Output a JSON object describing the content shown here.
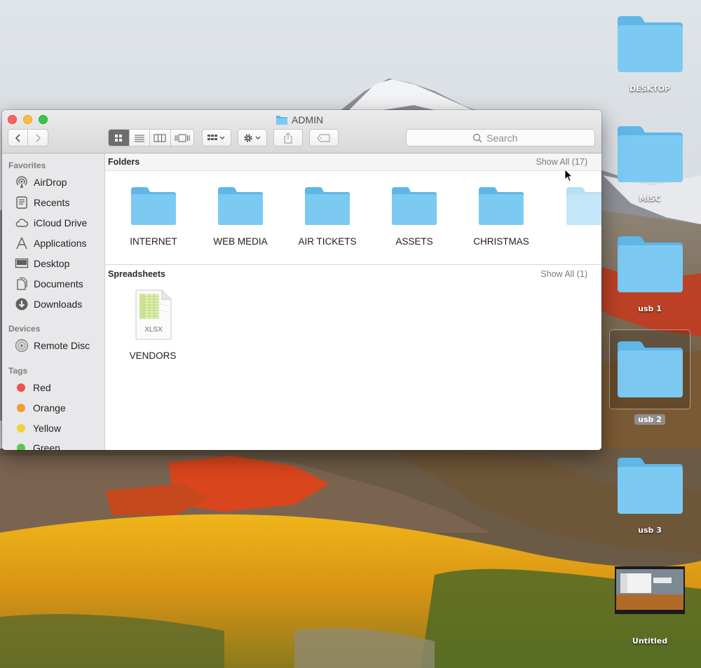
{
  "window": {
    "title": "ADMIN"
  },
  "toolbar": {
    "search_placeholder": "Search"
  },
  "sidebar": {
    "favorites_header": "Favorites",
    "favorites": [
      {
        "label": "AirDrop",
        "icon": "airdrop-icon"
      },
      {
        "label": "Recents",
        "icon": "clock-icon"
      },
      {
        "label": "iCloud Drive",
        "icon": "cloud-icon"
      },
      {
        "label": "Applications",
        "icon": "applications-icon"
      },
      {
        "label": "Desktop",
        "icon": "desktop-icon"
      },
      {
        "label": "Documents",
        "icon": "document-icon"
      },
      {
        "label": "Downloads",
        "icon": "download-icon"
      }
    ],
    "devices_header": "Devices",
    "devices": [
      {
        "label": "Remote Disc",
        "icon": "disc-icon"
      }
    ],
    "tags_header": "Tags",
    "tags": [
      {
        "label": "Red",
        "color": "#f3514d"
      },
      {
        "label": "Orange",
        "color": "#f39c34"
      },
      {
        "label": "Yellow",
        "color": "#f4cf3b"
      },
      {
        "label": "Green",
        "color": "#5bc84b"
      }
    ]
  },
  "folders_section": {
    "title": "Folders",
    "show_all": "Show All (17)",
    "items": [
      {
        "label": "INTERNET"
      },
      {
        "label": "WEB MEDIA"
      },
      {
        "label": "AIR TICKETS"
      },
      {
        "label": "ASSETS"
      },
      {
        "label": "CHRISTMAS"
      }
    ]
  },
  "spreadsheets_section": {
    "title": "Spreadsheets",
    "show_all": "Show All (1)",
    "items": [
      {
        "label": "VENDORS",
        "badge": "XLSX"
      }
    ]
  },
  "desktop_icons": [
    {
      "label": "DESKTOP"
    },
    {
      "label": "MISC"
    },
    {
      "label": "usb 1"
    },
    {
      "label": "usb 2"
    },
    {
      "label": "usb 3"
    },
    {
      "label": "Untitled"
    }
  ],
  "colors": {
    "folder_blue": "#7ccaf2",
    "folder_blue_dark": "#5fb7e8",
    "selected_segment": "#6d6d6d"
  }
}
